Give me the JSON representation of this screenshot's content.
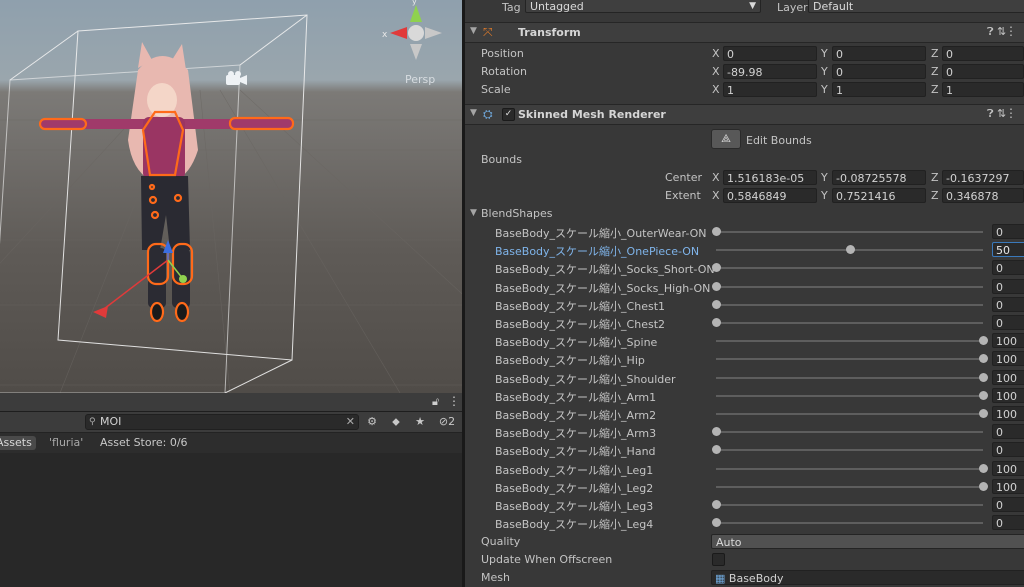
{
  "scene": {
    "projection_label": "Persp"
  },
  "project": {
    "search_value": "MOI",
    "breadcrumb_assets": "Assets",
    "breadcrumb_folder": "'fluria'",
    "asset_store": "Asset Store: 0/6",
    "hidden_count": "2"
  },
  "inspector": {
    "tag_label": "Tag",
    "tag_value": "Untagged",
    "layer_label": "Layer",
    "layer_value": "Default",
    "transform": {
      "title": "Transform",
      "position_label": "Position",
      "rotation_label": "Rotation",
      "scale_label": "Scale",
      "position": {
        "x": "0",
        "y": "0",
        "z": "0"
      },
      "rotation": {
        "x": "-89.98",
        "y": "0",
        "z": "0"
      },
      "scale": {
        "x": "1",
        "y": "1",
        "z": "1"
      }
    },
    "smr": {
      "title": "Skinned Mesh Renderer",
      "edit_bounds": "Edit Bounds",
      "bounds_label": "Bounds",
      "center_label": "Center",
      "extent_label": "Extent",
      "center": {
        "x": "1.516183e-05",
        "y": "-0.08725578",
        "z": "-0.1637297"
      },
      "extent": {
        "x": "0.5846849",
        "y": "0.7521416",
        "z": "0.346878"
      },
      "blendshapes_label": "BlendShapes",
      "blendshapes": [
        {
          "name": "BaseBody_スケール縮小_OuterWear-ON",
          "value": "0",
          "level": 0
        },
        {
          "name": "BaseBody_スケール縮小_OnePiece-ON",
          "value": "50",
          "level": 50
        },
        {
          "name": "BaseBody_スケール縮小_Socks_Short-ON",
          "value": "0",
          "level": 0
        },
        {
          "name": "BaseBody_スケール縮小_Socks_High-ON",
          "value": "0",
          "level": 0
        },
        {
          "name": "BaseBody_スケール縮小_Chest1",
          "value": "0",
          "level": 0
        },
        {
          "name": "BaseBody_スケール縮小_Chest2",
          "value": "0",
          "level": 0
        },
        {
          "name": "BaseBody_スケール縮小_Spine",
          "value": "100",
          "level": 100
        },
        {
          "name": "BaseBody_スケール縮小_Hip",
          "value": "100",
          "level": 100
        },
        {
          "name": "BaseBody_スケール縮小_Shoulder",
          "value": "100",
          "level": 100
        },
        {
          "name": "BaseBody_スケール縮小_Arm1",
          "value": "100",
          "level": 100
        },
        {
          "name": "BaseBody_スケール縮小_Arm2",
          "value": "100",
          "level": 100
        },
        {
          "name": "BaseBody_スケール縮小_Arm3",
          "value": "0",
          "level": 0
        },
        {
          "name": "BaseBody_スケール縮小_Hand",
          "value": "0",
          "level": 0
        },
        {
          "name": "BaseBody_スケール縮小_Leg1",
          "value": "100",
          "level": 100
        },
        {
          "name": "BaseBody_スケール縮小_Leg2",
          "value": "100",
          "level": 100
        },
        {
          "name": "BaseBody_スケール縮小_Leg3",
          "value": "0",
          "level": 0
        },
        {
          "name": "BaseBody_スケール縮小_Leg4",
          "value": "0",
          "level": 0
        }
      ],
      "quality_label": "Quality",
      "quality_value": "Auto",
      "update_offscreen_label": "Update When Offscreen",
      "mesh_label": "Mesh",
      "mesh_value": "BaseBody"
    }
  },
  "colors": {
    "selection_outline": "#ff6a1a",
    "selected_text": "#7fb4ea",
    "gizmo_y": "#8fd14f",
    "gizmo_x": "#e03a3a",
    "gizmo_z": "#3a6ee0"
  }
}
